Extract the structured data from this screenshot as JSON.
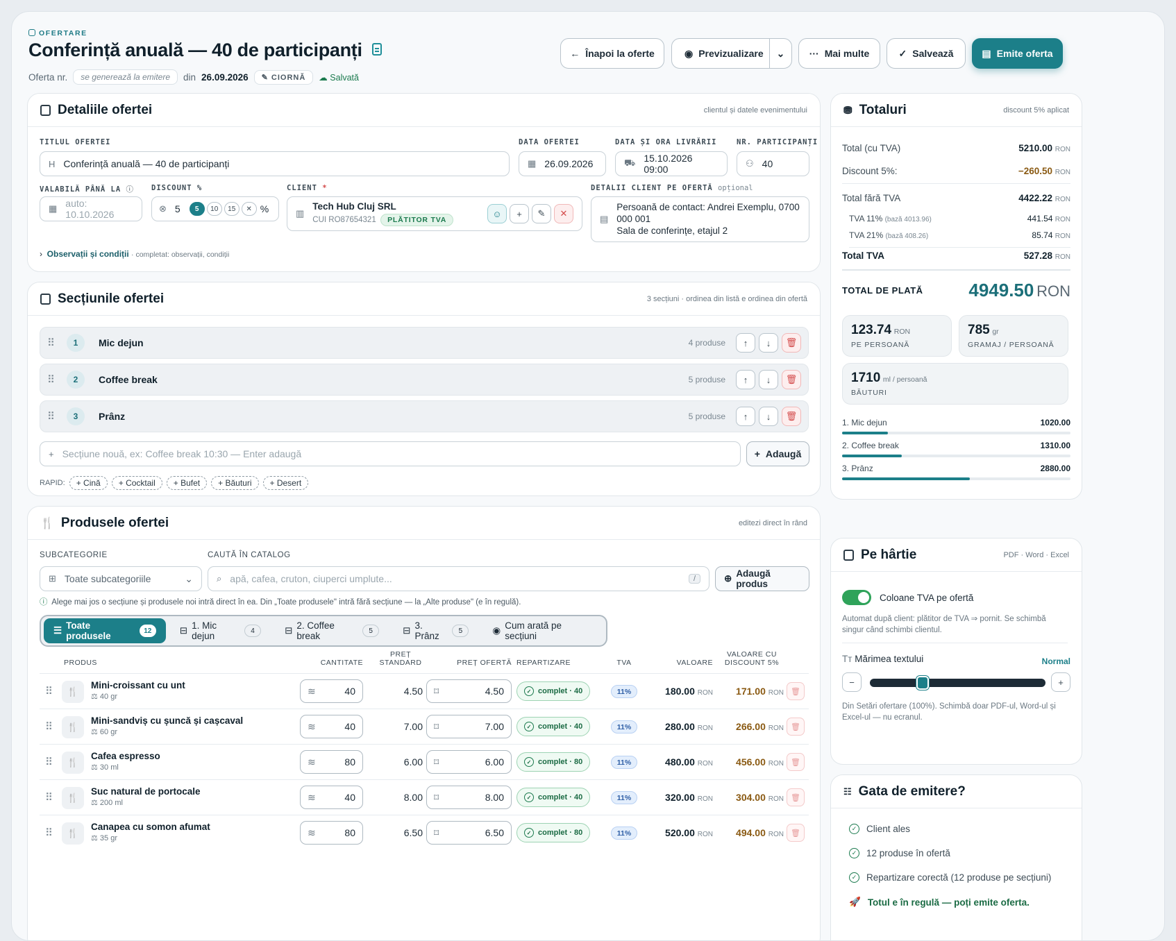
{
  "header": {
    "eyebrow": "OFERTARE",
    "title": "Conferință anuală — 40 de participanți",
    "offer_no_label": "Oferta nr.",
    "offer_no_value": "se generează la emitere",
    "date_prefix": "din",
    "date": "26.09.2026",
    "draft_badge": "CIORNĂ",
    "saved": "Salvată",
    "buttons": {
      "back": "Înapoi la oferte",
      "preview": "Previzualizare",
      "more": "Mai multe",
      "save": "Salvează",
      "issue": "Emite oferta"
    }
  },
  "details": {
    "title": "Detaliile ofertei",
    "hint": "clientul și datele evenimentului",
    "offer_title_label": "TITLUL OFERTEI",
    "offer_title_value": "Conferință anuală — 40 de participanți",
    "offer_date_label": "DATA OFERTEI",
    "offer_date_value": "26.09.2026",
    "delivery_label": "DATA ȘI ORA LIVRĂRII",
    "delivery_value": "15.10.2026 09:00",
    "participants_label": "NR. PARTICIPANȚI",
    "participants_value": "40",
    "valid_label": "VALABILĂ PÂNĂ LA",
    "valid_placeholder": "auto: 10.10.2026",
    "discount_label": "DISCOUNT %",
    "discount_value": "5",
    "discount_chips": [
      "5",
      "10",
      "15"
    ],
    "discount_unit": "%",
    "client_label": "CLIENT",
    "client_required": "*",
    "client_name": "Tech Hub Cluj SRL",
    "client_cui": "CUI RO87654321",
    "client_badge": "PLĂTITOR TVA",
    "client_details_label": "DETALII CLIENT PE OFERTĂ",
    "client_details_optional": "opțional",
    "client_details_text": "Persoană de contact: Andrei Exemplu, 0700 000 001\nSala de conferințe, etajul 2",
    "notes_link": "Observații și condiții",
    "notes_hint": "· completat: observații, condiții"
  },
  "sections": {
    "title": "Secțiunile ofertei",
    "hint": "3 secțiuni · ordinea din listă e ordinea din ofertă",
    "items": [
      {
        "num": "1",
        "name": "Mic dejun",
        "count": "4 produse"
      },
      {
        "num": "2",
        "name": "Coffee break",
        "count": "5 produse"
      },
      {
        "num": "3",
        "name": "Prânz",
        "count": "5 produse"
      }
    ],
    "new_placeholder": "Secțiune nouă, ex: Coffee break 10:30 — Enter adaugă",
    "add_button": "Adaugă",
    "rapid_label": "RAPID:",
    "rapid": [
      "Cină",
      "Cocktail",
      "Bufet",
      "Băuturi",
      "Desert"
    ]
  },
  "products": {
    "title": "Produsele ofertei",
    "hint": "editezi direct în rând",
    "subcat_label": "SUBCATEGORIE",
    "subcat_value": "Toate subcategoriile",
    "search_label": "CAUTĂ ÎN CATALOG",
    "search_placeholder": "apă, cafea, cruton, ciuperci umplute...",
    "search_shortcut": "/",
    "add_product": "Adaugă produs",
    "info": "Alege mai jos o secțiune și produsele noi intră direct în ea. Din „Toate produsele\" intră fără secțiune — la „Alte produse\" (e în regulă).",
    "tabs": [
      {
        "label": "Toate produsele",
        "badge": "12"
      },
      {
        "label": "1. Mic dejun",
        "badge": "4"
      },
      {
        "label": "2. Coffee break",
        "badge": "5"
      },
      {
        "label": "3. Prânz",
        "badge": "5"
      },
      {
        "label": "Cum arată pe secțiuni",
        "badge": ""
      }
    ],
    "columns": {
      "product": "PRODUS",
      "qty": "CANTITATE",
      "std_price": "PREȚ STANDARD",
      "offer_price": "PREȚ OFERTĂ",
      "split": "REPARTIZARE",
      "vat": "TVA",
      "value": "VALOARE",
      "value_disc": "VALOARE CU DISCOUNT 5%"
    },
    "currency": "RON",
    "rows": [
      {
        "name": "Mini-croissant cu unt",
        "weight": "40 gr",
        "qty": "40",
        "std": "4.50",
        "offer": "4.50",
        "split": "complet · 40",
        "vat": "11%",
        "value": "180.00",
        "disc": "171.00"
      },
      {
        "name": "Mini-sandviș cu șuncă și cașcaval",
        "weight": "60 gr",
        "qty": "40",
        "std": "7.00",
        "offer": "7.00",
        "split": "complet · 40",
        "vat": "11%",
        "value": "280.00",
        "disc": "266.00"
      },
      {
        "name": "Cafea espresso",
        "weight": "30 ml",
        "qty": "80",
        "std": "6.00",
        "offer": "6.00",
        "split": "complet · 80",
        "vat": "11%",
        "value": "480.00",
        "disc": "456.00"
      },
      {
        "name": "Suc natural de portocale",
        "weight": "200 ml",
        "qty": "40",
        "std": "8.00",
        "offer": "8.00",
        "split": "complet · 40",
        "vat": "11%",
        "value": "320.00",
        "disc": "304.00"
      },
      {
        "name": "Canapea cu somon afumat",
        "weight": "35 gr",
        "qty": "80",
        "std": "6.50",
        "offer": "6.50",
        "split": "complet · 80",
        "vat": "11%",
        "value": "520.00",
        "disc": "494.00"
      }
    ]
  },
  "totals": {
    "title": "Totaluri",
    "hint": "discount 5% aplicat",
    "currency": "RON",
    "total_with_vat_label": "Total (cu TVA)",
    "total_with_vat": "5210.00",
    "discount_label": "Discount 5%:",
    "discount": "−260.50",
    "total_no_vat_label": "Total fără TVA",
    "total_no_vat": "4422.22",
    "vat11_label": "TVA 11%",
    "vat11_base": "(bază 4013.96)",
    "vat11": "441.54",
    "vat21_label": "TVA 21%",
    "vat21_base": "(bază 408.26)",
    "vat21": "85.74",
    "total_vat_label": "Total TVA",
    "total_vat": "527.28",
    "grand_label": "TOTAL DE PLATĂ",
    "grand": "4949.50",
    "per_person": "123.74",
    "per_person_unit": "RON",
    "per_person_label": "PE PERSOANĂ",
    "grams": "785",
    "grams_unit": "gr",
    "grams_label": "GRAMAJ / PERSOANĂ",
    "drinks": "1710",
    "drinks_unit": "ml / persoană",
    "drinks_label": "BĂUTURI",
    "breakdown": [
      {
        "label": "1. Mic dejun",
        "value": "1020.00",
        "share": 0.2
      },
      {
        "label": "2. Coffee break",
        "value": "1310.00",
        "share": 0.26
      },
      {
        "label": "3. Prânz",
        "value": "2880.00",
        "share": 0.56
      }
    ]
  },
  "paper": {
    "title": "Pe hârtie",
    "hint": "PDF · Word · Excel",
    "vat_toggle_label": "Coloane TVA pe ofertă",
    "vat_toggle_on": true,
    "vat_toggle_help": "Automat după client: plătitor de TVA ⇒ pornit. Se schimbă singur când schimbi clientul.",
    "text_size_label": "Mărimea textului",
    "text_size_value": "Normal",
    "text_size_level": 0.3,
    "text_size_help": "Din Setări ofertare (100%). Schimbă doar PDF-ul, Word-ul și Excel-ul — nu ecranul."
  },
  "ready": {
    "title": "Gata de emitere?",
    "items": [
      "Client ales",
      "12 produse în ofertă",
      "Repartizare corectă (12 produse pe secțiuni)"
    ],
    "final": "Totul e în regulă — poți emite oferta."
  },
  "colors": {
    "accent": "#1c7f89",
    "green": "#1b7a4e",
    "danger": "#d34b4b",
    "discount": "#8a5a13"
  }
}
